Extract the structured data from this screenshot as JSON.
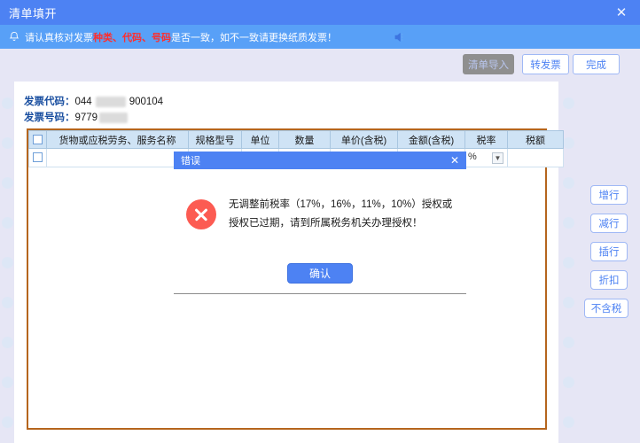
{
  "window": {
    "title": "清单填开",
    "close_label": "✕"
  },
  "notice": {
    "bell_icon": "bell-icon",
    "speaker_icon": "speaker-icon",
    "prefix": "请认真核对发票",
    "highlight": "种类、代码、号码",
    "suffix": "是否一致，如不一致请更换纸质发票！"
  },
  "toolbar": {
    "import_label": "清单导入",
    "to_invoice_label": "转发票",
    "finish_label": "完成"
  },
  "invoice": {
    "code_label": "发票代码：",
    "code_prefix": "044",
    "code_suffix": "900104",
    "number_label": "发票号码：",
    "number_prefix": "9779"
  },
  "table": {
    "columns": [
      "",
      "货物或应税劳务、服务名称",
      "规格型号",
      "单位",
      "数量",
      "单价(含税)",
      "金额(含税)",
      "税率",
      "税额"
    ],
    "rows": [
      {
        "name": "",
        "spec": "",
        "unit": "",
        "qty": "",
        "price": "",
        "amount": "",
        "rate": "%",
        "rate_arrow": "▼",
        "tax": ""
      }
    ]
  },
  "sidebar": {
    "buttons": [
      {
        "label": "增行",
        "name": "add-row-button"
      },
      {
        "label": "减行",
        "name": "remove-row-button"
      },
      {
        "label": "插行",
        "name": "insert-row-button"
      },
      {
        "label": "折扣",
        "name": "discount-button"
      },
      {
        "label": "不含税",
        "name": "exclude-tax-button"
      }
    ]
  },
  "dialog": {
    "title": "错误",
    "close_label": "✕",
    "icon": "error-circle-icon",
    "message": "无调整前税率（17%，16%，11%，10%）授权或授权已过期，请到所属税务机关办理授权！",
    "confirm_label": "确认"
  },
  "colors": {
    "title_blue": "#4d82f3",
    "notice_blue": "#58a0f7",
    "panel_bg": "#e6e6f5",
    "table_border": "#b5651d",
    "header_blue": "#cfe3f5",
    "error_red": "#fc5b52",
    "highlight_red": "#ff2d2d"
  }
}
